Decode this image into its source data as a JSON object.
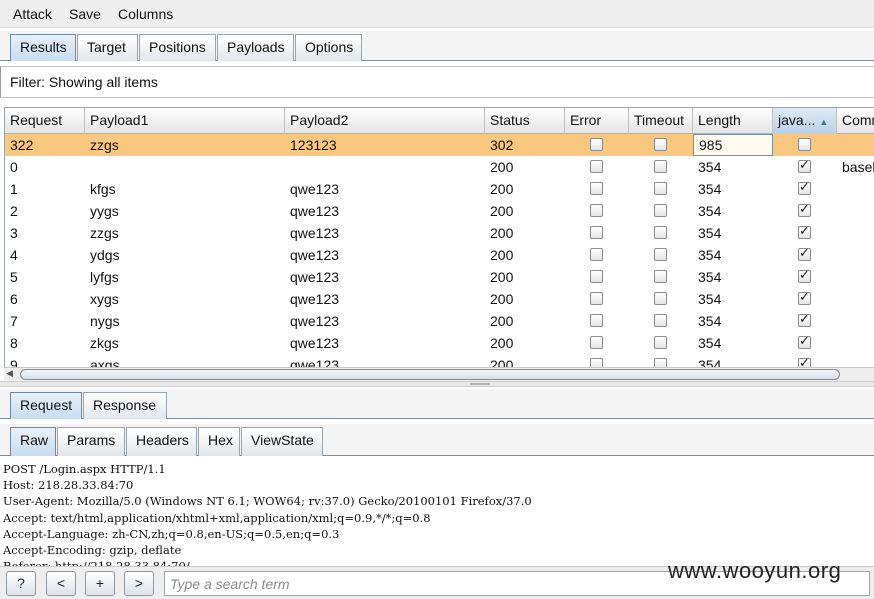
{
  "menu": [
    "Attack",
    "Save",
    "Columns"
  ],
  "main_tabs": [
    "Results",
    "Target",
    "Positions",
    "Payloads",
    "Options"
  ],
  "filter_text": "Filter: Showing all items",
  "table": {
    "columns": [
      "Request",
      "Payload1",
      "Payload2",
      "Status",
      "Error",
      "Timeout",
      "Length",
      "java...",
      "Comm"
    ],
    "sort_column": "java...",
    "sort_direction": "ascending",
    "rows": [
      {
        "request": "322",
        "payload1": "zzgs",
        "payload2": "123123",
        "status": "302",
        "error": false,
        "timeout": false,
        "length": "985",
        "java": false,
        "comment": "",
        "selected": true
      },
      {
        "request": "0",
        "payload1": "",
        "payload2": "",
        "status": "200",
        "error": false,
        "timeout": false,
        "length": "354",
        "java": true,
        "comment": "basel",
        "selected": false
      },
      {
        "request": "1",
        "payload1": "kfgs",
        "payload2": "qwe123",
        "status": "200",
        "error": false,
        "timeout": false,
        "length": "354",
        "java": true,
        "comment": "",
        "selected": false
      },
      {
        "request": "2",
        "payload1": "yygs",
        "payload2": "qwe123",
        "status": "200",
        "error": false,
        "timeout": false,
        "length": "354",
        "java": true,
        "comment": "",
        "selected": false
      },
      {
        "request": "3",
        "payload1": "zzgs",
        "payload2": "qwe123",
        "status": "200",
        "error": false,
        "timeout": false,
        "length": "354",
        "java": true,
        "comment": "",
        "selected": false
      },
      {
        "request": "4",
        "payload1": "ydgs",
        "payload2": "qwe123",
        "status": "200",
        "error": false,
        "timeout": false,
        "length": "354",
        "java": true,
        "comment": "",
        "selected": false
      },
      {
        "request": "5",
        "payload1": "lyfgs",
        "payload2": "qwe123",
        "status": "200",
        "error": false,
        "timeout": false,
        "length": "354",
        "java": true,
        "comment": "",
        "selected": false
      },
      {
        "request": "6",
        "payload1": "xygs",
        "payload2": "qwe123",
        "status": "200",
        "error": false,
        "timeout": false,
        "length": "354",
        "java": true,
        "comment": "",
        "selected": false
      },
      {
        "request": "7",
        "payload1": "nygs",
        "payload2": "qwe123",
        "status": "200",
        "error": false,
        "timeout": false,
        "length": "354",
        "java": true,
        "comment": "",
        "selected": false
      },
      {
        "request": "8",
        "payload1": "zkgs",
        "payload2": "qwe123",
        "status": "200",
        "error": false,
        "timeout": false,
        "length": "354",
        "java": true,
        "comment": "",
        "selected": false
      },
      {
        "request": "9",
        "payload1": "axgs",
        "payload2": "qwe123",
        "status": "200",
        "error": false,
        "timeout": false,
        "length": "354",
        "java": true,
        "comment": "",
        "selected": false
      }
    ]
  },
  "detail_tabs": [
    "Request",
    "Response"
  ],
  "format_tabs": [
    "Raw",
    "Params",
    "Headers",
    "Hex",
    "ViewState"
  ],
  "raw_lines": [
    "POST /Login.aspx HTTP/1.1",
    "Host: 218.28.33.84:70",
    "User-Agent: Mozilla/5.0 (Windows NT 6.1; WOW64; rv:37.0) Gecko/20100101 Firefox/37.0",
    "Accept: text/html,application/xhtml+xml,application/xml;q=0.9,*/*;q=0.8",
    "Accept-Language: zh-CN,zh;q=0.8,en-US;q=0.5,en;q=0.3",
    "Accept-Encoding: gzip, deflate",
    "Referer: http://218.28.33.84:70/"
  ],
  "bottom": {
    "help_label": "?",
    "prev_label": "<",
    "add_label": "+",
    "next_label": ">",
    "search_placeholder": "Type a search term"
  },
  "watermark": "www.wooyun.org",
  "colors": {
    "selected_row": "#f9c77e",
    "active_tab": "#c7dcef"
  }
}
